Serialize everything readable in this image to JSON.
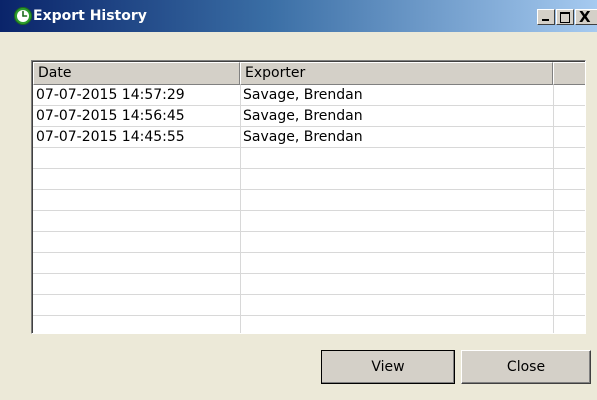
{
  "window": {
    "title": "Export History",
    "icon": "green-clock-icon",
    "controls": {
      "minimize": "minimize-icon",
      "maximize": "maximize-icon",
      "close_glyph": "X"
    }
  },
  "table": {
    "columns": [
      "Date",
      "Exporter",
      ""
    ],
    "rows": [
      {
        "date": "07-07-2015 14:57:29",
        "exporter": "Savage, Brendan"
      },
      {
        "date": "07-07-2015 14:56:45",
        "exporter": "Savage, Brendan"
      },
      {
        "date": "07-07-2015 14:45:55",
        "exporter": "Savage, Brendan"
      },
      {
        "date": "",
        "exporter": ""
      },
      {
        "date": "",
        "exporter": ""
      },
      {
        "date": "",
        "exporter": ""
      },
      {
        "date": "",
        "exporter": ""
      },
      {
        "date": "",
        "exporter": ""
      },
      {
        "date": "",
        "exporter": ""
      },
      {
        "date": "",
        "exporter": ""
      },
      {
        "date": "",
        "exporter": ""
      },
      {
        "date": "",
        "exporter": ""
      }
    ]
  },
  "buttons": {
    "view": "View",
    "close": "Close"
  },
  "colors": {
    "title_start": "#0a246a",
    "title_end": "#a6caf0",
    "dialog_bg": "#ece9d8",
    "icon_green": "#2e9e2e"
  }
}
